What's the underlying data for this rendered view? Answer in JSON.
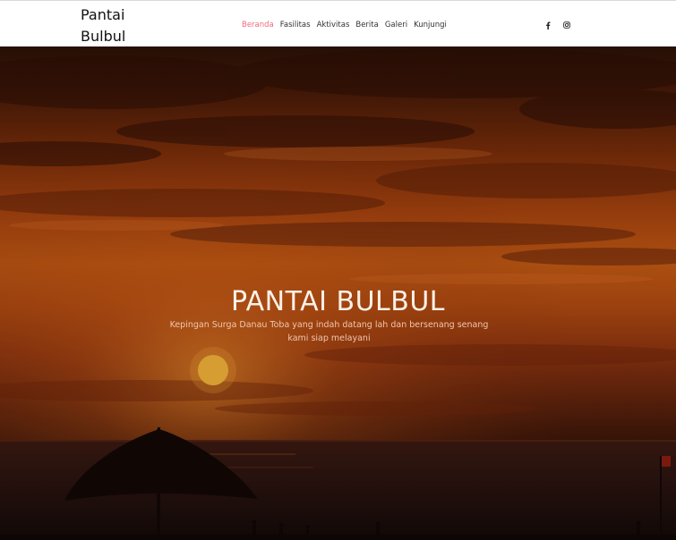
{
  "brand": {
    "line1": "Pantai",
    "line2": "Bulbul"
  },
  "nav": {
    "items": [
      {
        "label": "Beranda",
        "active": true
      },
      {
        "label": "Fasilitas",
        "active": false
      },
      {
        "label": "Aktivitas",
        "active": false
      },
      {
        "label": "Berita",
        "active": false
      },
      {
        "label": "Galeri",
        "active": false
      },
      {
        "label": "Kunjungi",
        "active": false
      }
    ],
    "social": [
      "facebook-icon",
      "instagram-icon"
    ]
  },
  "hero": {
    "title": "PANTAI BULBUL",
    "subtitle": "Kepingan Surga Danau Toba yang indah datang lah dan bersenang senang kami siap melayani"
  },
  "colors": {
    "active_nav": "#f06a7a",
    "nav_text": "#333333",
    "hero_title": "#fbf1e8",
    "hero_subtitle": "#f1c7ad"
  }
}
